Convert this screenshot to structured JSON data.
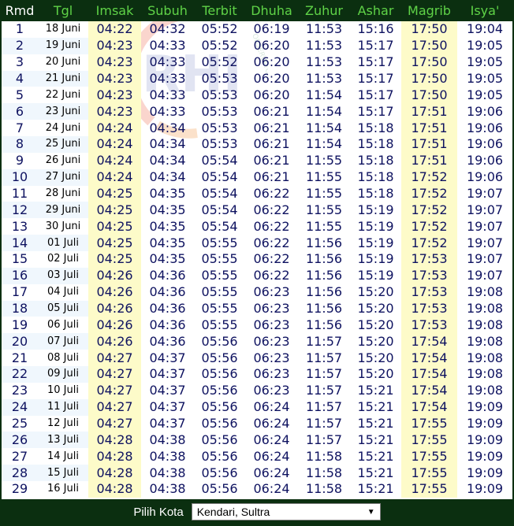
{
  "header": {
    "columns": [
      {
        "label": "Rmd",
        "color": "#ffffff"
      },
      {
        "label": "Tgl",
        "color": "#5fd347"
      },
      {
        "label": "Imsak",
        "color": "#5fd347"
      },
      {
        "label": "Subuh",
        "color": "#5fd347"
      },
      {
        "label": "Terbit",
        "color": "#5fd347"
      },
      {
        "label": "Dhuha",
        "color": "#5fd347"
      },
      {
        "label": "Zuhur",
        "color": "#5fd347"
      },
      {
        "label": "Ashar",
        "color": "#5fd347"
      },
      {
        "label": "Magrib",
        "color": "#5fd347"
      },
      {
        "label": "Isya'",
        "color": "#5fd347"
      }
    ]
  },
  "rows": [
    [
      "1",
      "18 Juni",
      "04:22",
      "04:32",
      "05:52",
      "06:19",
      "11:53",
      "15:16",
      "17:50",
      "19:04"
    ],
    [
      "2",
      "19 Juni",
      "04:23",
      "04:33",
      "05:52",
      "06:20",
      "11:53",
      "15:17",
      "17:50",
      "19:05"
    ],
    [
      "3",
      "20 Juni",
      "04:23",
      "04:33",
      "05:52",
      "06:20",
      "11:53",
      "15:17",
      "17:50",
      "19:05"
    ],
    [
      "4",
      "21 Juni",
      "04:23",
      "04:33",
      "05:53",
      "06:20",
      "11:53",
      "15:17",
      "17:50",
      "19:05"
    ],
    [
      "5",
      "22 Juni",
      "04:23",
      "04:33",
      "05:53",
      "06:20",
      "11:54",
      "15:17",
      "17:50",
      "19:05"
    ],
    [
      "6",
      "23 Juni",
      "04:23",
      "04:33",
      "05:53",
      "06:21",
      "11:54",
      "15:17",
      "17:51",
      "19:06"
    ],
    [
      "7",
      "24 Juni",
      "04:24",
      "04:34",
      "05:53",
      "06:21",
      "11:54",
      "15:18",
      "17:51",
      "19:06"
    ],
    [
      "8",
      "25 Juni",
      "04:24",
      "04:34",
      "05:53",
      "06:21",
      "11:54",
      "15:18",
      "17:51",
      "19:06"
    ],
    [
      "9",
      "26 Juni",
      "04:24",
      "04:34",
      "05:54",
      "06:21",
      "11:55",
      "15:18",
      "17:51",
      "19:06"
    ],
    [
      "10",
      "27 Juni",
      "04:24",
      "04:34",
      "05:54",
      "06:21",
      "11:55",
      "15:18",
      "17:52",
      "19:06"
    ],
    [
      "11",
      "28 Juni",
      "04:25",
      "04:35",
      "05:54",
      "06:22",
      "11:55",
      "15:18",
      "17:52",
      "19:07"
    ],
    [
      "12",
      "29 Juni",
      "04:25",
      "04:35",
      "05:54",
      "06:22",
      "11:55",
      "15:19",
      "17:52",
      "19:07"
    ],
    [
      "13",
      "30 Juni",
      "04:25",
      "04:35",
      "05:54",
      "06:22",
      "11:55",
      "15:19",
      "17:52",
      "19:07"
    ],
    [
      "14",
      "01 Juli",
      "04:25",
      "04:35",
      "05:55",
      "06:22",
      "11:56",
      "15:19",
      "17:52",
      "19:07"
    ],
    [
      "15",
      "02 Juli",
      "04:25",
      "04:35",
      "05:55",
      "06:22",
      "11:56",
      "15:19",
      "17:53",
      "19:07"
    ],
    [
      "16",
      "03 Juli",
      "04:26",
      "04:36",
      "05:55",
      "06:22",
      "11:56",
      "15:19",
      "17:53",
      "19:07"
    ],
    [
      "17",
      "04 Juli",
      "04:26",
      "04:36",
      "05:55",
      "06:23",
      "11:56",
      "15:20",
      "17:53",
      "19:08"
    ],
    [
      "18",
      "05 Juli",
      "04:26",
      "04:36",
      "05:55",
      "06:23",
      "11:56",
      "15:20",
      "17:53",
      "19:08"
    ],
    [
      "19",
      "06 Juli",
      "04:26",
      "04:36",
      "05:55",
      "06:23",
      "11:56",
      "15:20",
      "17:53",
      "19:08"
    ],
    [
      "20",
      "07 Juli",
      "04:26",
      "04:36",
      "05:56",
      "06:23",
      "11:57",
      "15:20",
      "17:54",
      "19:08"
    ],
    [
      "21",
      "08 Juli",
      "04:27",
      "04:37",
      "05:56",
      "06:23",
      "11:57",
      "15:20",
      "17:54",
      "19:08"
    ],
    [
      "22",
      "09 Juli",
      "04:27",
      "04:37",
      "05:56",
      "06:23",
      "11:57",
      "15:20",
      "17:54",
      "19:08"
    ],
    [
      "23",
      "10 Juli",
      "04:27",
      "04:37",
      "05:56",
      "06:23",
      "11:57",
      "15:21",
      "17:54",
      "19:08"
    ],
    [
      "24",
      "11 Juli",
      "04:27",
      "04:37",
      "05:56",
      "06:24",
      "11:57",
      "15:21",
      "17:54",
      "19:09"
    ],
    [
      "25",
      "12 Juli",
      "04:27",
      "04:37",
      "05:56",
      "06:24",
      "11:57",
      "15:21",
      "17:55",
      "19:09"
    ],
    [
      "26",
      "13 Juli",
      "04:28",
      "04:38",
      "05:56",
      "06:24",
      "11:57",
      "15:21",
      "17:55",
      "19:09"
    ],
    [
      "27",
      "14 Juli",
      "04:28",
      "04:38",
      "05:56",
      "06:24",
      "11:58",
      "15:21",
      "17:55",
      "19:09"
    ],
    [
      "28",
      "15 Juli",
      "04:28",
      "04:38",
      "05:56",
      "06:24",
      "11:58",
      "15:21",
      "17:55",
      "19:09"
    ],
    [
      "29",
      "16 Juli",
      "04:28",
      "04:38",
      "05:56",
      "06:24",
      "11:58",
      "15:21",
      "17:55",
      "19:09"
    ]
  ],
  "highlight_columns": [
    2,
    8
  ],
  "footer": {
    "city_label": "Pilih Kota",
    "city_selected": "Kendari, Sultra"
  },
  "watermark": {
    "letters": "RHI",
    "icon": "rhi-observatory-logo"
  },
  "colors": {
    "header_bg": "#0b2f10",
    "header_text": "#5fd347",
    "cell_text": "#0e1260",
    "highlight_bg": "#fdfbc9",
    "alt_row_bg": "#f0f7fd"
  }
}
